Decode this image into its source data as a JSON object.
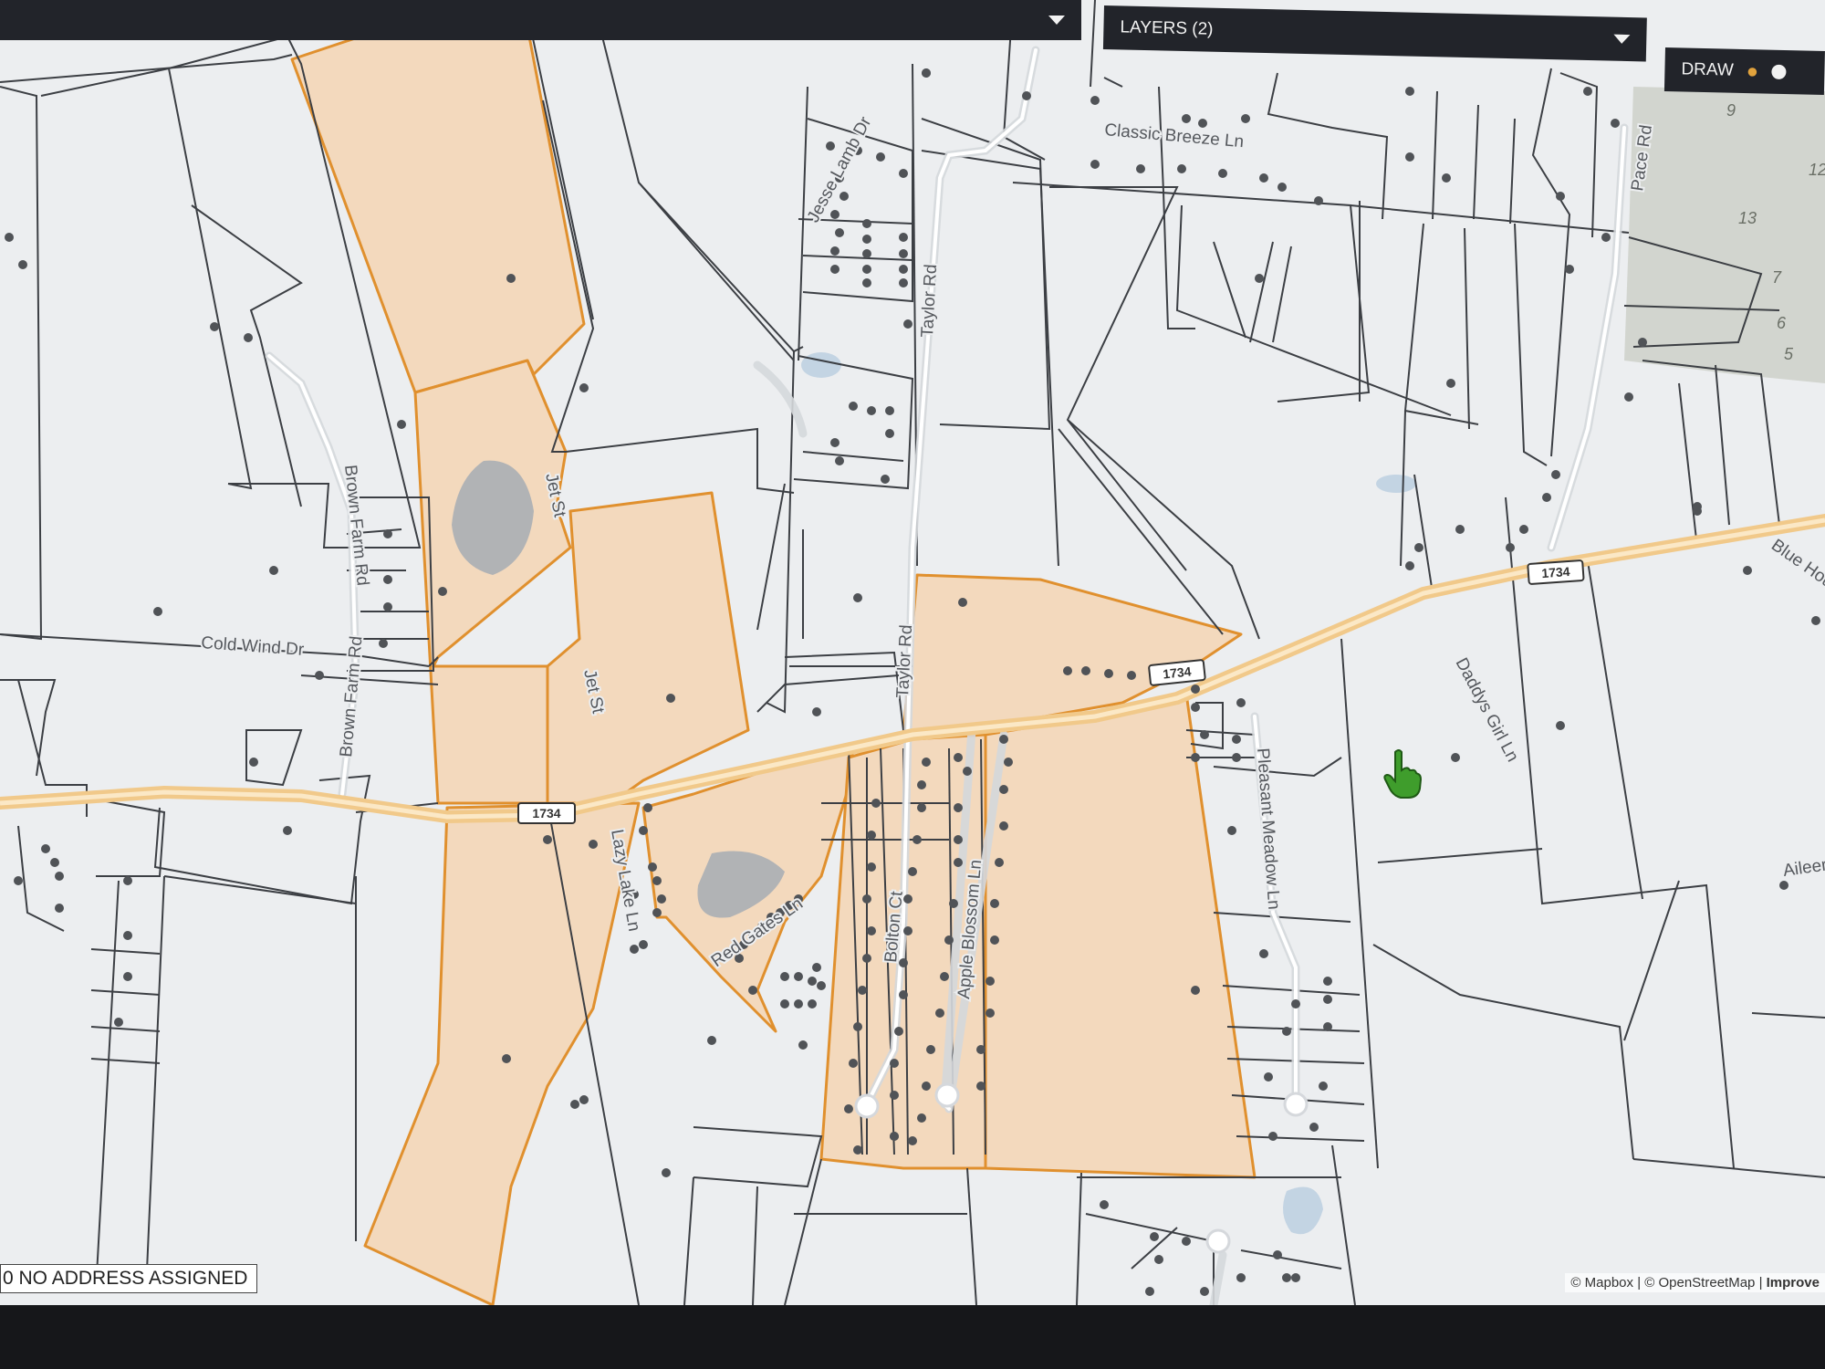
{
  "toolbar": {
    "layers_label": "LAYERS (2)",
    "draw_label": "DRAW",
    "palette_icon": "palette-icon",
    "circle_icon": "circle-icon",
    "dropdown_icon": "caret-down-icon"
  },
  "status": {
    "address_badge": "0 NO ADDRESS ASSIGNED"
  },
  "attribution": {
    "mapbox": "© Mapbox",
    "separator": "|",
    "osm": "© OpenStreetMap",
    "improve": "Improve"
  },
  "map": {
    "highway_shield": "1734",
    "highway_shields": [
      "1734",
      "1734",
      "1734"
    ],
    "roads": [
      "Classic Breeze Ln",
      "Jesse Lamb Dr",
      "Pace Rd",
      "Taylor Rd",
      "Taylor Rd",
      "Brown Farm Rd",
      "Brown Farm Rd",
      "Jet St",
      "Jet St",
      "Cold Wind Dr",
      "Lazy Lake Ln",
      "Bolton Ct",
      "Apple Blossom Ln",
      "Pleasant Meadow Ln",
      "Daddys Girl Ln",
      "Blue Hou",
      "Aileer",
      "Red Gates Ln"
    ],
    "lot_numbers": [
      "9",
      "12",
      "13",
      "7",
      "6",
      "5"
    ],
    "colors": {
      "background": "#eceef0",
      "parcel_line": "#3c3f44",
      "selected_fill": "#f3d9bd",
      "selected_stroke": "#e0902e",
      "highway": "#f1c98a",
      "water": "#b9cde0",
      "building": "#505357",
      "toolbar": "#22242a",
      "cursor": "#3f9d2c"
    },
    "cursor_icon": "hand-pointer-icon"
  }
}
